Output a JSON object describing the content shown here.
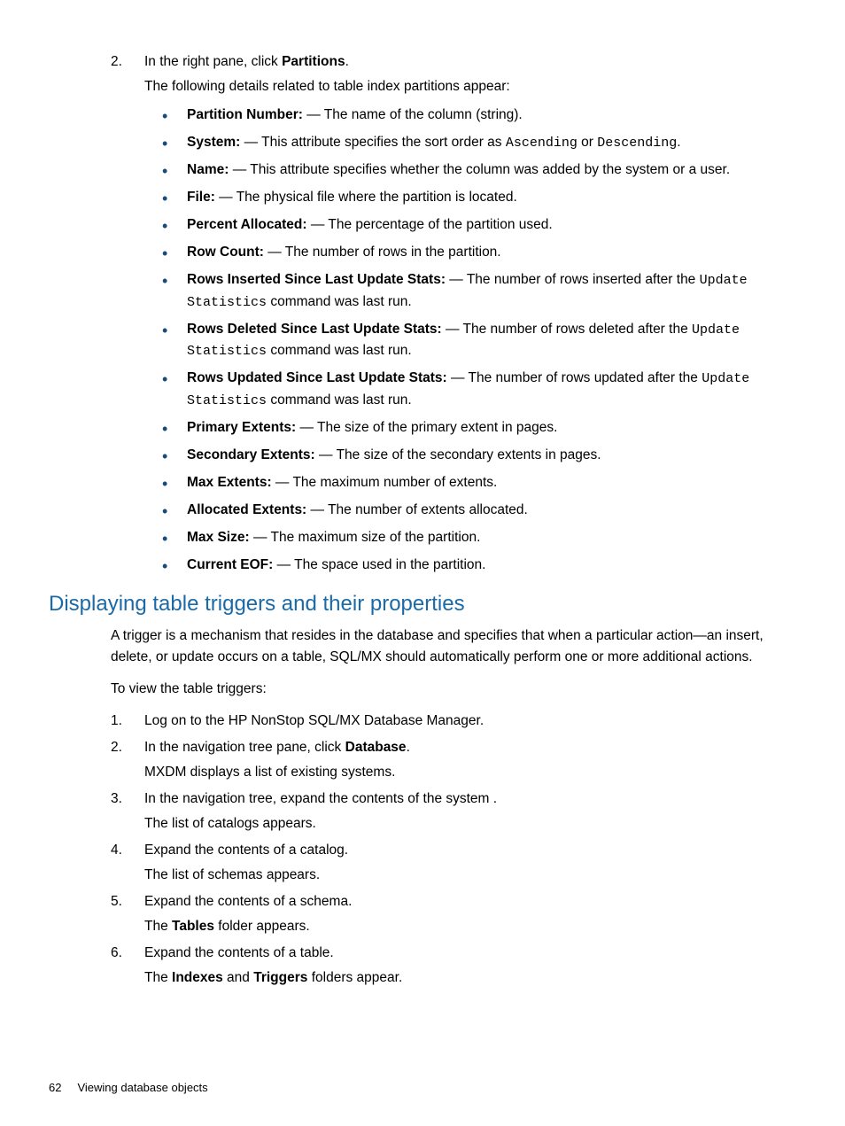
{
  "step2": {
    "num": "2.",
    "line1_a": "In the right pane, click ",
    "line1_b": "Partitions",
    "line1_c": ".",
    "line2": "The following details related to table index partitions appear:"
  },
  "bullets": [
    {
      "term": "Partition Number:",
      "sep": " — ",
      "desc": "The name of the column (string)."
    },
    {
      "term": "System:",
      "sep": " — ",
      "desc_a": "This attribute specifies the sort order as ",
      "code_a": "Ascending",
      "mid": " or ",
      "code_b": "Descending",
      "tail": "."
    },
    {
      "term": "Name:",
      "sep": " — ",
      "desc": "This attribute specifies whether the column was added by the system or a user."
    },
    {
      "term": "File:",
      "sep": " — ",
      "desc": "The physical file where the partition is located."
    },
    {
      "term": "Percent Allocated:",
      "sep": " — ",
      "desc": "The percentage of the partition used."
    },
    {
      "term": "Row Count:",
      "sep": " — ",
      "desc": "The number of rows in the partition."
    },
    {
      "term": "Rows Inserted Since Last Update Stats:",
      "sep": " — ",
      "desc_a": "The number of rows inserted after the ",
      "code_a": "Update Statistics",
      "tail": " command was last run."
    },
    {
      "term": "Rows Deleted Since Last Update Stats:",
      "sep": " — ",
      "desc_a": "The number of rows deleted after the ",
      "code_a": "Update Statistics",
      "tail": " command was last run."
    },
    {
      "term": "Rows Updated Since Last Update Stats:",
      "sep": " — ",
      "desc_a": "The number of rows updated after the ",
      "code_a": "Update Statistics",
      "tail": " command was last run."
    },
    {
      "term": "Primary Extents:",
      "sep": " — ",
      "desc": "The size of the primary extent in pages."
    },
    {
      "term": "Secondary Extents:",
      "sep": " — ",
      "desc": "The size of the secondary extents in pages."
    },
    {
      "term": "Max Extents:",
      "sep": " — ",
      "desc": "The maximum number of extents."
    },
    {
      "term": "Allocated Extents:",
      "sep": " — ",
      "desc": "The number of extents allocated."
    },
    {
      "term": "Max Size:",
      "sep": " — ",
      "desc": "The maximum size of the partition."
    },
    {
      "term": "Current EOF:",
      "sep": " — ",
      "desc": "The space used in the partition."
    }
  ],
  "heading": "Displaying table triggers and their properties",
  "intro": "A trigger is a mechanism that resides in the database and specifies that when a particular action—an insert, delete, or update occurs on a table, SQL/MX should automatically perform one or more additional actions.",
  "lead": "To view the table triggers:",
  "steps": [
    {
      "num": "1.",
      "text": "Log on to the HP NonStop SQL/MX Database Manager."
    },
    {
      "num": "2.",
      "text_a": "In the navigation tree pane, click ",
      "bold_a": "Database",
      "text_b": ".",
      "sub": "MXDM displays a list of existing systems."
    },
    {
      "num": "3.",
      "text": "In the navigation tree, expand the contents of the system .",
      "sub": "The list of catalogs appears."
    },
    {
      "num": "4.",
      "text": "Expand the contents of a catalog.",
      "sub": "The list of schemas appears."
    },
    {
      "num": "5.",
      "text": "Expand the contents of a schema.",
      "sub_a": "The ",
      "sub_bold_a": "Tables",
      "sub_b": " folder appears."
    },
    {
      "num": "6.",
      "text": "Expand the contents of a table.",
      "sub_a": "The ",
      "sub_bold_a": "Indexes",
      "sub_mid": " and ",
      "sub_bold_b": "Triggers",
      "sub_b": " folders appear."
    }
  ],
  "footer": {
    "page": "62",
    "title": "Viewing database objects"
  }
}
